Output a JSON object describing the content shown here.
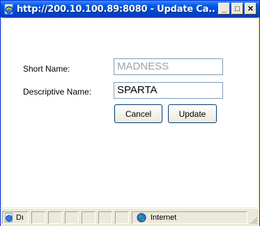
{
  "window": {
    "title": "http://200.10.100.89:8080 - Update Ca...",
    "buttons": {
      "minimize": "_",
      "maximize": "□",
      "close": "✕"
    }
  },
  "form": {
    "short_name_label": "Short Name:",
    "short_name_value": "MADNESS",
    "descriptive_name_label": "Descriptive Name:",
    "descriptive_name_value": "SPARTA",
    "cancel_label": "Cancel",
    "update_label": "Update"
  },
  "statusbar": {
    "left_text": "Dı",
    "zone_text": "Internet"
  },
  "colors": {
    "titlebar": "#0058e6",
    "disabled_text": "#a0a0a0"
  },
  "icons": {
    "title": "ie-page-icon",
    "status_page": "ie-page-icon",
    "zone": "globe-icon"
  }
}
